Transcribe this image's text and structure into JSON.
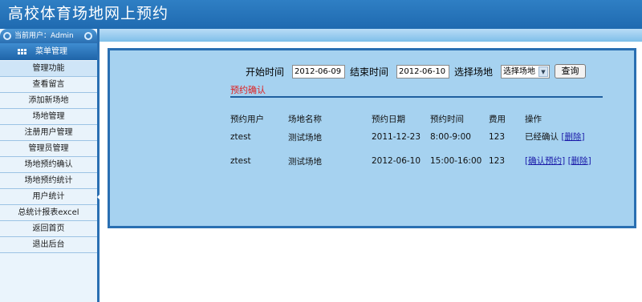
{
  "header": {
    "title": "高校体育场地网上预约"
  },
  "sidebar": {
    "current_user": "当前用户：Admin",
    "menu_title": "菜单管理",
    "items": [
      {
        "label": "管理功能"
      },
      {
        "label": "查看留言"
      },
      {
        "label": "添加新场地"
      },
      {
        "label": "场地管理"
      },
      {
        "label": "注册用户管理"
      },
      {
        "label": "管理员管理"
      },
      {
        "label": "场地预约确认"
      },
      {
        "label": "场地预约统计"
      },
      {
        "label": "用户统计"
      },
      {
        "label": "总统计报表excel"
      },
      {
        "label": "返回首页"
      },
      {
        "label": "退出后台"
      }
    ]
  },
  "search": {
    "start_label": "开始时间",
    "start_value": "2012-06-09",
    "end_label": "结束时间",
    "end_value": "2012-06-10",
    "venue_label": "选择场地",
    "venue_selected": "选择场地",
    "query_button": "查询"
  },
  "section_title": "预约确认",
  "table": {
    "columns": [
      "预约用户",
      "场地名称",
      "预约日期",
      "预约时间",
      "费用",
      "操作"
    ],
    "rows": [
      {
        "user": "ztest",
        "venue": "测试场地",
        "date": "2011-12-23",
        "time": "8:00-9:00",
        "fee": "123",
        "status": "已经确认",
        "bracket_open": "[",
        "action": "删除",
        "bracket_close": "]"
      },
      {
        "user": "ztest",
        "venue": "测试场地",
        "date": "2012-06-10",
        "time": "15:00-16:00",
        "fee": "123",
        "bracket_open": "[",
        "confirm": "确认预约",
        "bracket_close": "]",
        "bracket_open2": "[",
        "action": "删除",
        "bracket_close2": "]"
      }
    ]
  },
  "colors": {
    "header": "#2a76bd",
    "panel": "#a6d2f0",
    "border": "#2a6fb2",
    "accent_red": "#e02020"
  }
}
